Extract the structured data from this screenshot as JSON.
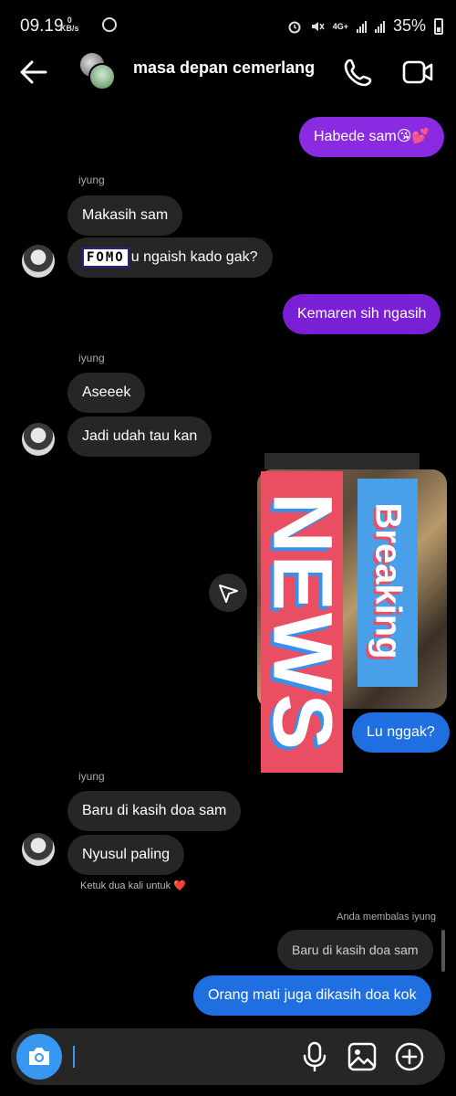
{
  "status_bar": {
    "time": "09.19",
    "net_speed_value": "0",
    "net_speed_unit": "KB/s",
    "network_type": "4G+",
    "battery": "35%"
  },
  "header": {
    "title": "masa depan cemerlang",
    "icons": [
      "back-arrow-icon",
      "phone-icon",
      "video-camera-icon"
    ]
  },
  "messages": {
    "m1": "Habede sam😘💕",
    "sender1": "iyung",
    "m2": "Makasih sam",
    "m3_sticker": "FOMO",
    "m3_text": "u ngaish kado gak?",
    "m4": "Kemaren sih ngasih",
    "sender2": "iyung",
    "m5": "Aseeek",
    "m6": "Jadi udah tau kan",
    "post_text_1": "Breaking",
    "post_text_2": "NEWS",
    "m7": "Lu nggak?",
    "sender3": "iyung",
    "m8": "Baru di kasih doa sam",
    "m9": "Nyusul paling",
    "hint": "Ketuk dua kali untuk ❤️",
    "reply_label": "Anda membalas iyung",
    "reply_quote": "Baru di kasih doa sam",
    "m10": "Orang mati juga dikasih doa kok"
  },
  "composer": {
    "placeholder": ""
  },
  "colors": {
    "outgoing_purple": "#8a2be2",
    "outgoing_blue": "#1f6fe0",
    "incoming": "#262626",
    "camera_button": "#3897f0"
  }
}
